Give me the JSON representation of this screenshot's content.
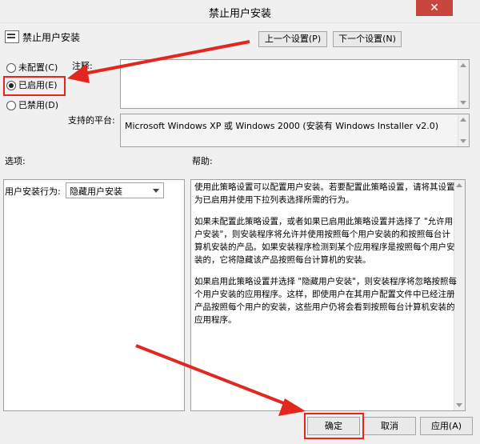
{
  "window": {
    "title": "禁止用户安装",
    "close_glyph": "✕"
  },
  "header": {
    "policy_name": "禁止用户安装",
    "prev_button": "上一个设置(P)",
    "next_button": "下一个设置(N)"
  },
  "radios": [
    {
      "label": "未配置(C)",
      "checked": false
    },
    {
      "label": "已启用(E)",
      "checked": true
    },
    {
      "label": "已禁用(D)",
      "checked": false
    }
  ],
  "comment": {
    "label": "注释:",
    "value": ""
  },
  "platform": {
    "label": "支持的平台:",
    "value": "Microsoft Windows XP 或 Windows 2000 (安装有 Windows Installer v2.0)"
  },
  "options": {
    "label": "选项:",
    "install_behavior_label": "用户安装行为:",
    "install_behavior_value": "隐藏用户安装"
  },
  "help": {
    "label": "帮助:",
    "paragraphs": [
      "使用此策略设置可以配置用户安装。若要配置此策略设置，请将其设置为已启用并使用下拉列表选择所需的行为。",
      "如果未配置此策略设置，或者如果已启用此策略设置并选择了 \"允许用户安装\"，则安装程序将允许并使用按照每个用户安装的和按照每台计算机安装的产品。如果安装程序检测到某个应用程序是按照每个用户安装的，它将隐藏该产品按照每台计算机的安装。",
      "如果启用此策略设置并选择 \"隐藏用户安装\"，则安装程序将忽略按照每个用户安装的应用程序。这样，即使用户在其用户配置文件中已经注册产品按照每个用户的安装，这些用户仍将会看到按照每台计算机安装的应用程序。"
    ]
  },
  "footer": {
    "ok": "确定",
    "cancel": "取消",
    "apply": "应用(A)"
  },
  "colors": {
    "highlight": "#e2271f",
    "close_button": "#c7463d"
  }
}
